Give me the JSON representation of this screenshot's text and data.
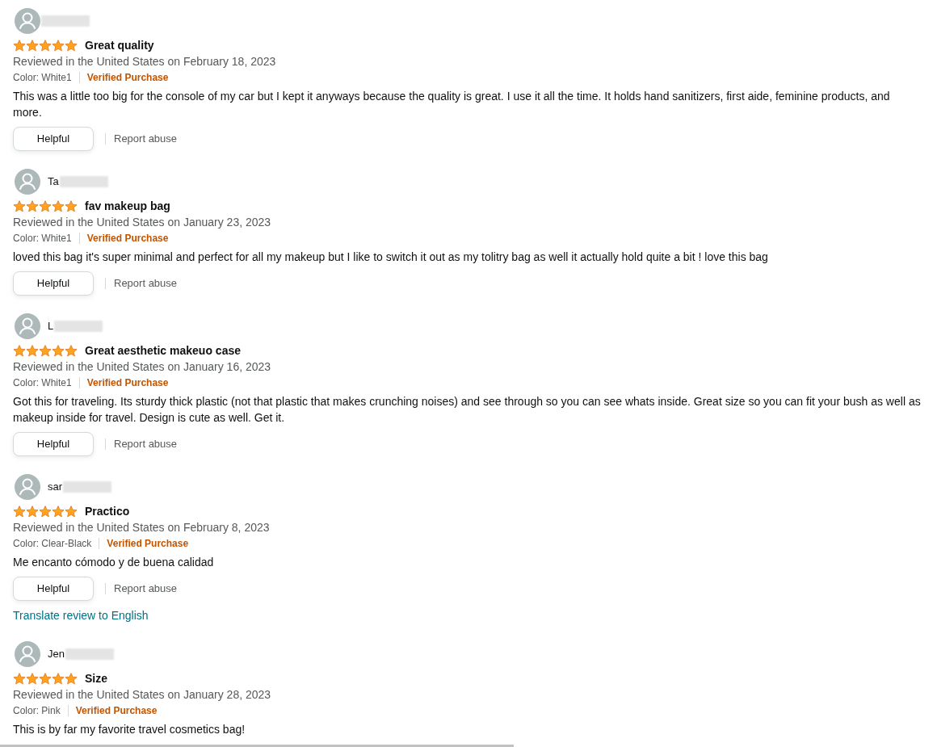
{
  "reviews": [
    {
      "stars": 5,
      "title": "Great quality",
      "date": "Reviewed in the United States on February 18, 2023",
      "color_option": "Color: White1",
      "badge": "Verified Purchase",
      "body": "This was a little too big for the console of my car but I kept it anyways because the quality is great. I use it all the time. It holds hand sanitizers, first aide, feminine products, and more.",
      "helpful": "Helpful",
      "report": "Report abuse"
    },
    {
      "name": "Ta",
      "stars": 5,
      "title": "fav makeup bag",
      "date": "Reviewed in the United States on January 23, 2023",
      "color_option": "Color: White1",
      "badge": "Verified Purchase",
      "body": "loved this bag it's super minimal and perfect for all my makeup but I like to switch it out as my tolitry bag as well it actually hold quite a bit ! love this bag",
      "helpful": "Helpful",
      "report": "Report abuse"
    },
    {
      "name": "L",
      "stars": 5,
      "title": "Great aesthetic makeuo case",
      "date": "Reviewed in the United States on January 16, 2023",
      "color_option": "Color: White1",
      "badge": "Verified Purchase",
      "body": "Got this for traveling. Its sturdy thick plastic (not that plastic that makes crunching noises) and see through so you can see whats inside. Great size so you can fit your bush as well as makeup inside for travel. Design is cute as well. Get it.",
      "helpful": "Helpful",
      "report": "Report abuse"
    },
    {
      "name": "sar",
      "stars": 5,
      "title": "Practico",
      "date": "Reviewed in the United States on February 8, 2023",
      "color_option": "Color: Clear-Black",
      "badge": "Verified Purchase",
      "body": "Me encanto cómodo y de buena calidad",
      "helpful": "Helpful",
      "report": "Report abuse",
      "translate": "Translate review to English"
    },
    {
      "name": "Jen",
      "stars": 5,
      "title": "Size",
      "date": "Reviewed in the United States on January 28, 2023",
      "color_option": "Color: Pink",
      "badge": "Verified Purchase",
      "body": "This is by far my favorite travel cosmetics bag!"
    }
  ]
}
